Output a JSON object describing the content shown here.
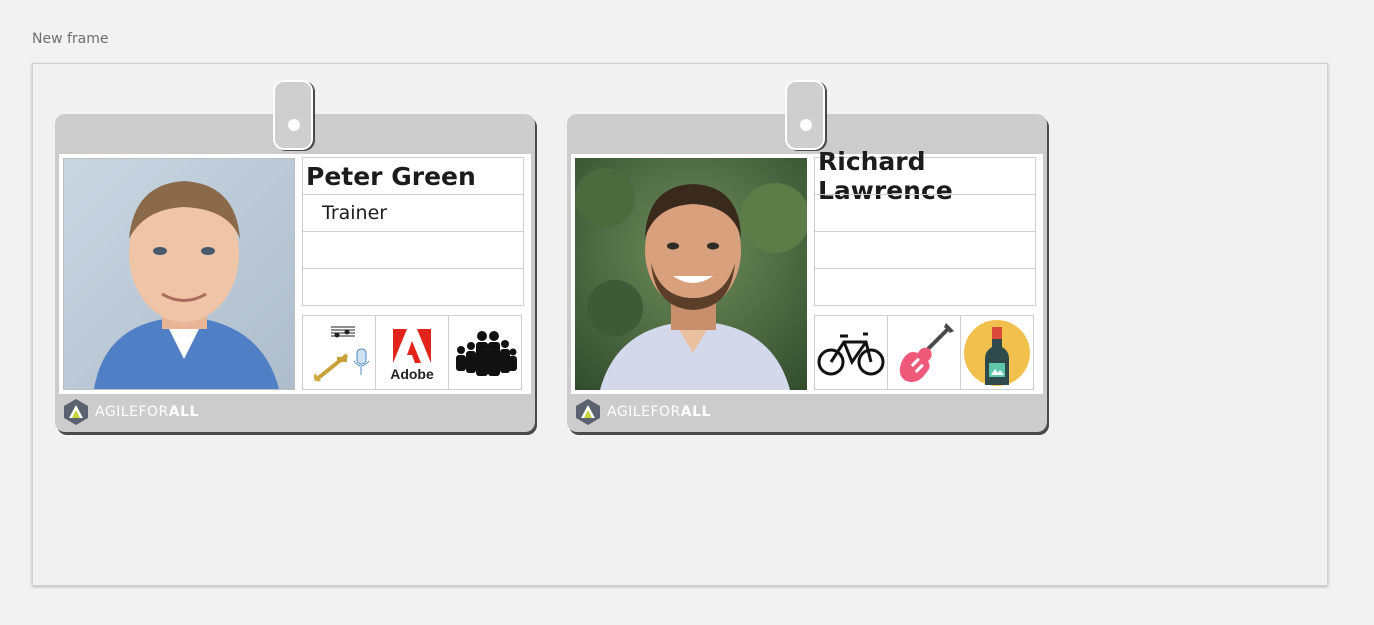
{
  "canvas": {
    "frame_label": "New frame"
  },
  "badges": [
    {
      "name": "Peter Green",
      "role": "Trainer",
      "fields": [
        "",
        ""
      ],
      "icons": [
        "music-trumpet-microphone-icon",
        "adobe-logo-icon",
        "family-icon"
      ],
      "icon_labels": {
        "adobe": "Adobe"
      },
      "brand_prefix": "AGILE",
      "brand_mid": "FOR",
      "brand_suffix": "ALL"
    },
    {
      "name": "Richard Lawrence",
      "role": "",
      "fields": [
        "",
        ""
      ],
      "icons": [
        "bicycle-icon",
        "electric-guitar-icon",
        "wine-bottle-icon"
      ],
      "brand_prefix": "AGILE",
      "brand_mid": "FOR",
      "brand_suffix": "ALL"
    }
  ],
  "colors": {
    "badge_gray": "#cccccc",
    "adobe_red": "#e2231a",
    "guitar_pink": "#ef5a7a",
    "wine_circle": "#f2c04c",
    "wine_bottle": "#2f6b6a"
  }
}
